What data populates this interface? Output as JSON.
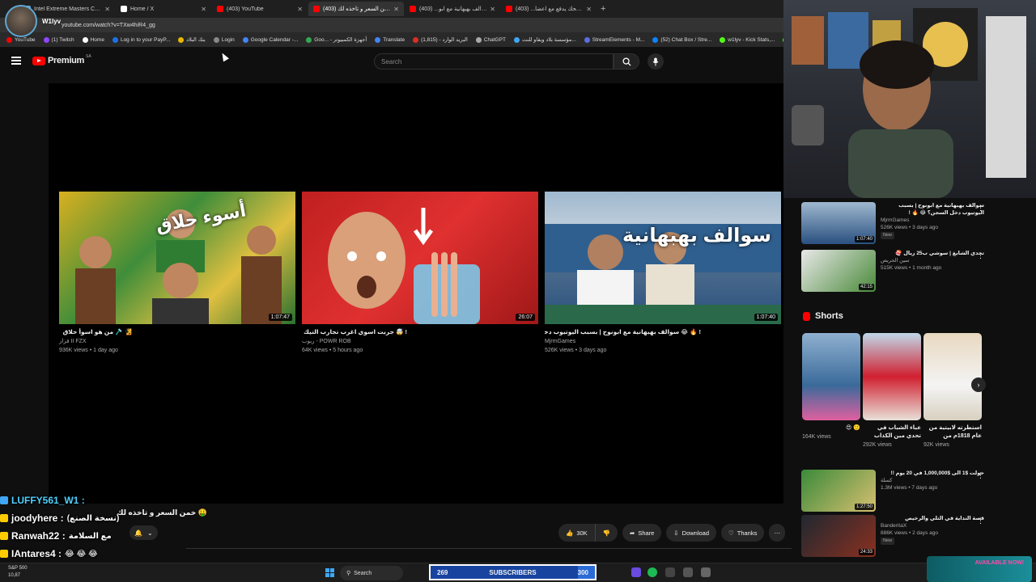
{
  "browser": {
    "tabs": [
      {
        "title": "Intel Extreme Masters Chengdu",
        "color": "#5fa8d3",
        "active": false
      },
      {
        "title": "Home / X",
        "color": "#ffffff",
        "active": false
      },
      {
        "title": "(403) YouTube",
        "color": "#ff0000",
        "active": false
      },
      {
        "title": "خمن السعر و تاخذه لك (403)",
        "color": "#ff0000",
        "active": true
      },
      {
        "title": "سوالف بهبهانية مع ابو... (403)",
        "color": "#ff0000",
        "active": false
      },
      {
        "title": "اللي يضحك يدفع مع اعضا... (403)",
        "color": "#ff0000",
        "active": false
      }
    ],
    "new_tab": "+",
    "url": "youtube.com/watch?v=TXw4hiR4_gg",
    "bookmarks": [
      "YouTube",
      "(1) Twitch",
      "Home",
      "Log in to your PayP...",
      "بنك البلاد",
      "Login",
      "Google Calendar -...",
      "Goo... - أجهزة الكمبيوتر",
      "Translate",
      "البريد الوارد - (1,815)",
      "ChatGPT",
      "مؤسسة بلاد ويقاو للنت...",
      "StreamElements - M...",
      "(52) Chat Box / Stre...",
      "w1lyv - Kick Stats,...",
      "Kick"
    ]
  },
  "stream_overlay": {
    "streamer_name": "W1lyv"
  },
  "header": {
    "brand": "Premium",
    "country": "SA",
    "search_placeholder": "Search"
  },
  "endcards": [
    {
      "title": "🧏 🪒 من هو اسوأ حلاق",
      "channel": "فزاز II FZX",
      "meta": "936K views • 1 day ago",
      "duration": "1:07:47",
      "thumb_text": "أسوء حلاق"
    },
    {
      "title": "! 🤯 جربت اسوي اغرب تجارب التيك توك",
      "channel": "ربوب - POWR ROB",
      "meta": "64K views • 5 hours ago",
      "duration": "26:07",
      "thumb_text": ""
    },
    {
      "title": "! 🔥 😂 سوالف بهبهانية مع ابونوح | بسبب اليوتيوب دخل السجن؟",
      "channel": "MjrmGames",
      "meta": "526K views • 3 days ago",
      "duration": "1:07:40",
      "thumb_text": "سوالف بهبهانية"
    }
  ],
  "video": {
    "title": "خمن السعر و تاخذه لك 🤑",
    "likes": "30K",
    "share": "Share",
    "download": "Download",
    "thanks": "Thanks"
  },
  "chat": [
    {
      "name": "LUFFY561_W1 :",
      "msg": "",
      "color": "#4fd0ff",
      "badge": "#3fa7f5"
    },
    {
      "name": "joodyhere :",
      "msg": "(نسخة الصنع)",
      "color": "#ffffff",
      "badge": "#ffcc00"
    },
    {
      "name": "Ranwah22 :",
      "msg": "مع السلامة",
      "color": "#ffffff",
      "badge": "#ffcc00"
    },
    {
      "name": "IAntares4 :",
      "msg": "😂 😂 😂",
      "color": "#ffffff",
      "badge": "#ffcc00"
    }
  ],
  "sidebar": {
    "items": [
      {
        "title": "سوالف بهبهانية مع ابونوح | بسبب اليوتيوب دخل السجن؟ 😂 🔥 !",
        "channel": "MjrmGames",
        "meta": "526K views • 3 days ago",
        "duration": "1:07:40",
        "badge": "New"
      },
      {
        "title": "تحدي الشابغ | سوشي ب25 ريال 🍣",
        "channel": "سين الحريص",
        "meta": "515K views • 1 month ago",
        "duration": "42:15",
        "badge": ""
      },
      {
        "title": "حولت $1 الى $1,000,000 في 20 يوم !!",
        "channel": "كسلة",
        "meta": "1.3M views • 7 days ago",
        "duration": "1:27:50",
        "badge": ""
      },
      {
        "title": "قصة النداية في التلي والرخيص",
        "channel": "BanderitaX",
        "meta": "886K views • 2 days ago",
        "duration": "24:33",
        "badge": "New"
      }
    ],
    "shorts_title": "Shorts",
    "shorts": [
      {
        "title": "🙂 😍",
        "views": "164K views"
      },
      {
        "title": "عباء الشباب في تحدي مين الكذاب",
        "views": "292K views"
      },
      {
        "title": "استطرته لابيتية من عام 1818م من",
        "views": "92K views"
      }
    ]
  },
  "taskbar": {
    "stock_name": "S&P 500",
    "stock_value": "10,87",
    "search_label": "Search",
    "subs_current": "269",
    "subs_label": "SUBSCRIBERS",
    "subs_goal": "300",
    "subs_progress": 0.897,
    "promo": "AVAILABLE NOW!"
  }
}
